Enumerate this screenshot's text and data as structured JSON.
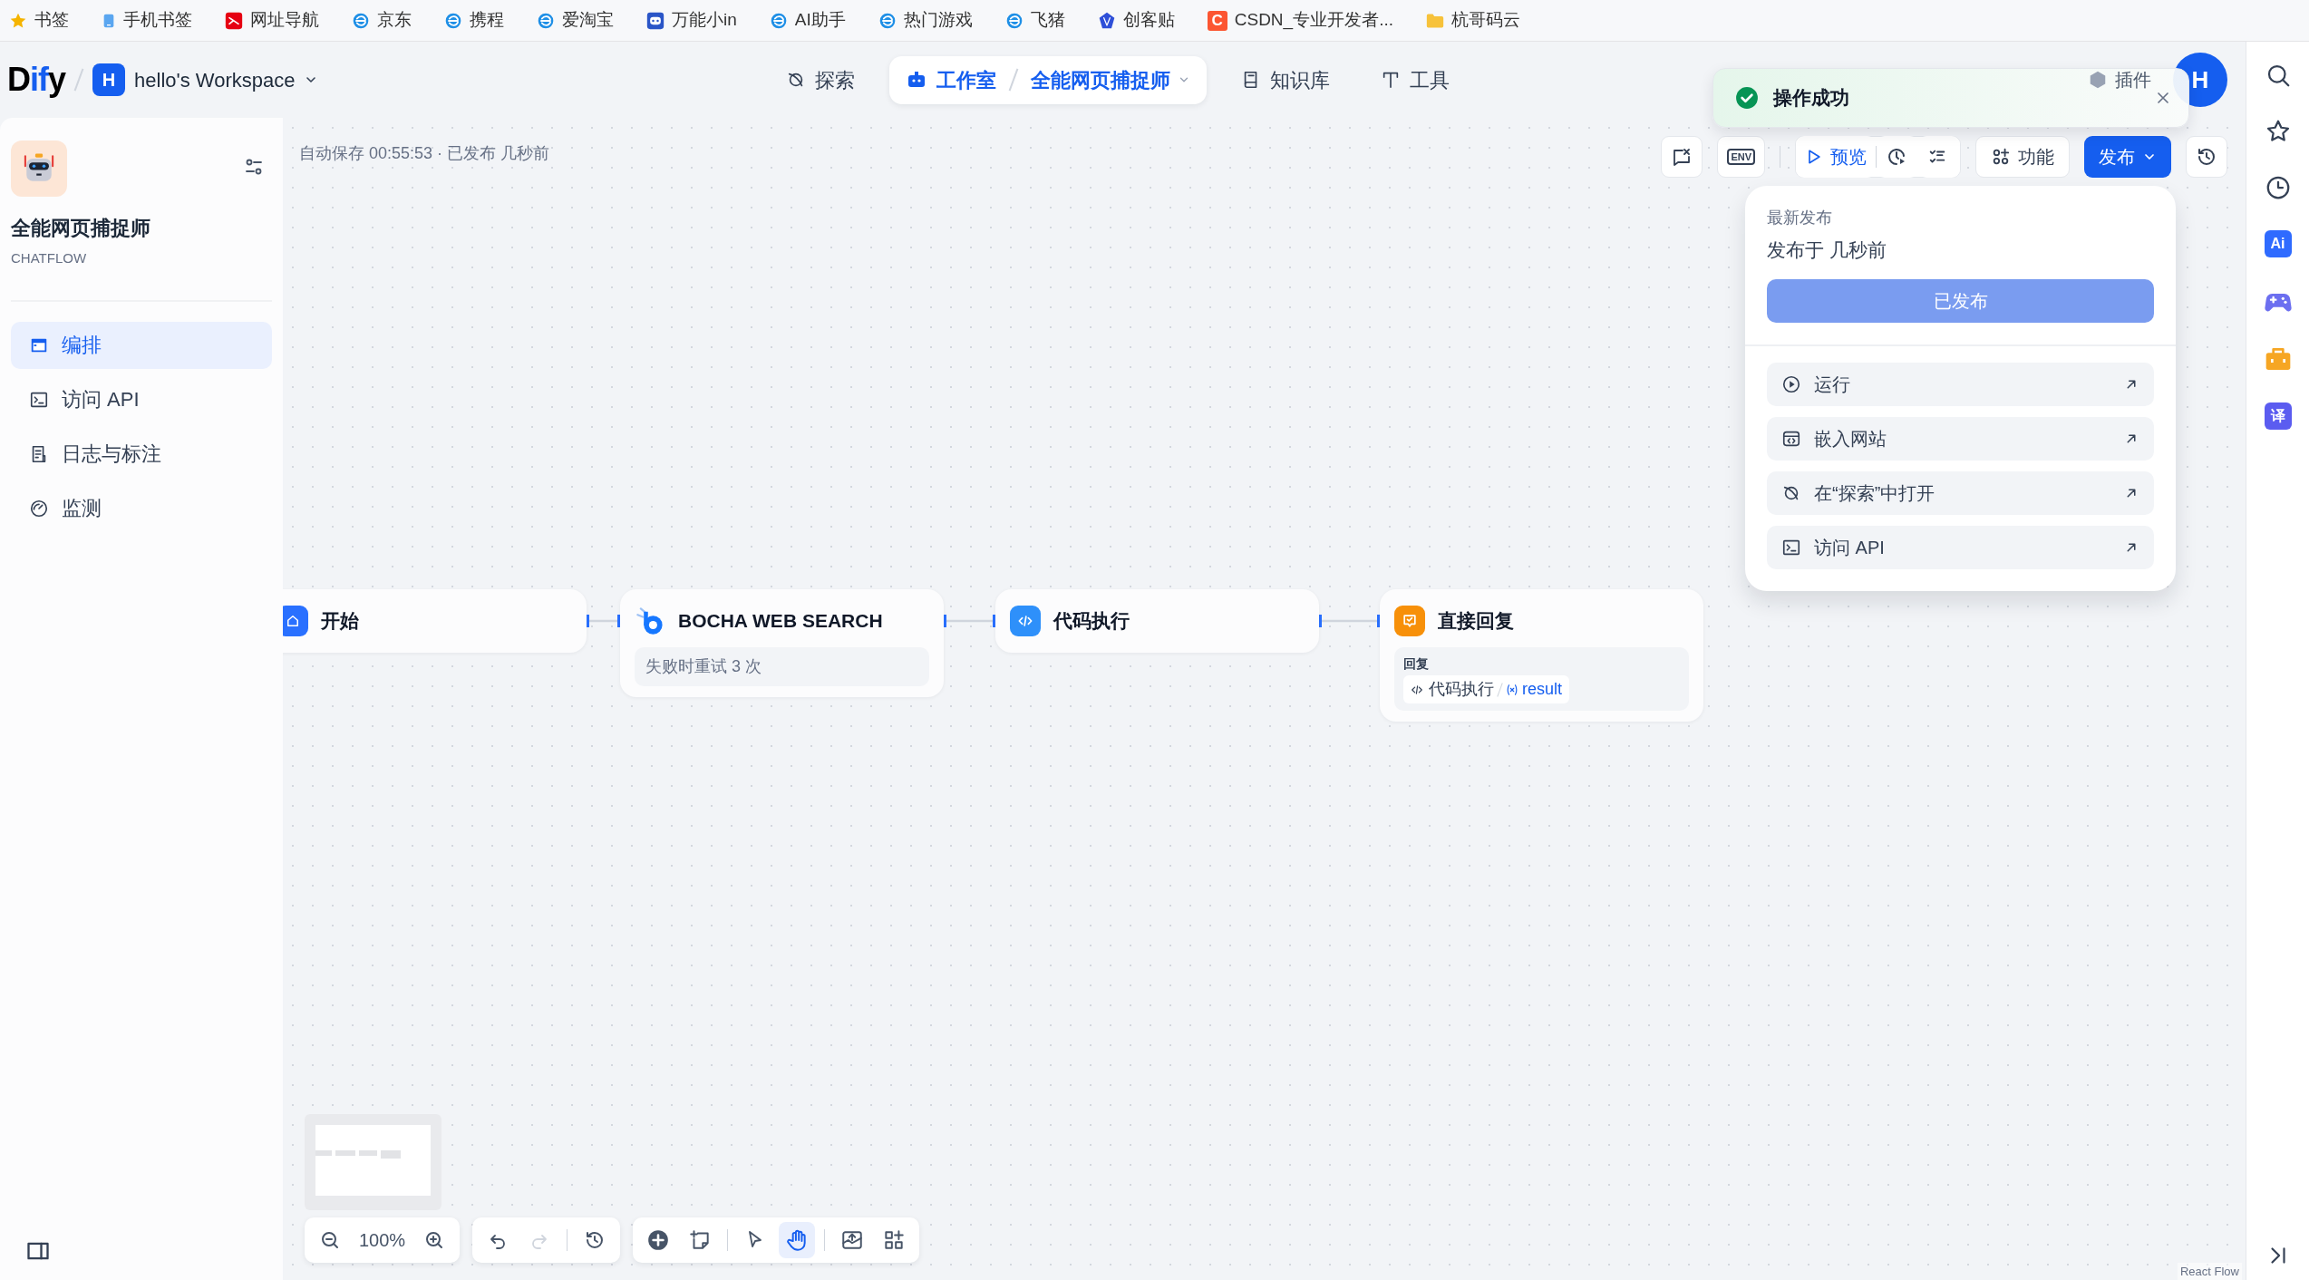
{
  "bookmarks": [
    {
      "label": "书签",
      "kind": "star"
    },
    {
      "label": "手机书签",
      "kind": "phone"
    },
    {
      "label": "网址导航",
      "kind": "red"
    },
    {
      "label": "京东",
      "kind": "browser"
    },
    {
      "label": "携程",
      "kind": "browser"
    },
    {
      "label": "爱淘宝",
      "kind": "browser"
    },
    {
      "label": "万能小in",
      "kind": "robot"
    },
    {
      "label": "AI助手",
      "kind": "browser"
    },
    {
      "label": "热门游戏",
      "kind": "browser"
    },
    {
      "label": "飞猪",
      "kind": "browser"
    },
    {
      "label": "创客贴",
      "kind": "gem"
    },
    {
      "label": "CSDN_专业开发者...",
      "kind": "letter",
      "letter": "C"
    },
    {
      "label": "杭哥码云",
      "kind": "folder"
    }
  ],
  "header": {
    "logo": "Dify",
    "workspace": {
      "initial": "H",
      "name": "hello's Workspace"
    },
    "nav": [
      {
        "label": "探索",
        "kind": "explore",
        "selected": false
      },
      {
        "label": "工作室",
        "kind": "studio",
        "selected": true,
        "current_app": "全能网页捕捉师"
      },
      {
        "label": "知识库",
        "kind": "knowledge",
        "selected": false
      },
      {
        "label": "工具",
        "kind": "tools",
        "selected": false
      }
    ],
    "plugins": "插件",
    "avatar": "H"
  },
  "toast": {
    "message": "操作成功",
    "kind": "success"
  },
  "sidebar": {
    "app_name": "全能网页捕捉师",
    "app_type": "CHATFLOW",
    "items": [
      {
        "label": "编排",
        "kind": "orchestrate",
        "selected": true
      },
      {
        "label": "访问 API",
        "kind": "api",
        "selected": false
      },
      {
        "label": "日志与标注",
        "kind": "logs",
        "selected": false
      },
      {
        "label": "监测",
        "kind": "monitor",
        "selected": false
      }
    ]
  },
  "canvas": {
    "status": "自动保存 00:55:53 · 已发布 几秒前",
    "toolbar": {
      "env": "ENV",
      "preview": "预览",
      "features": "功能",
      "publish": "发布"
    },
    "publish_menu": {
      "heading": "最新发布",
      "published_at": "发布于 几秒前",
      "button": {
        "label": "已发布",
        "disabled": true
      },
      "actions": [
        {
          "label": "运行",
          "kind": "run"
        },
        {
          "label": "嵌入网站",
          "kind": "embed"
        },
        {
          "label": "在“探索”中打开",
          "kind": "explore"
        },
        {
          "label": "访问 API",
          "kind": "api"
        }
      ]
    },
    "nodes": [
      {
        "title": "开始",
        "kind": "start"
      },
      {
        "title": "BOCHA WEB SEARCH",
        "kind": "tool",
        "note": "失败时重试 3 次"
      },
      {
        "title": "代码执行",
        "kind": "code"
      },
      {
        "title": "直接回复",
        "kind": "answer",
        "answer": {
          "label": "回复",
          "source": "代码执行",
          "variable": "result"
        }
      }
    ],
    "controls": {
      "zoom": "100%",
      "history": [
        {
          "kind": "undo",
          "disabled": false
        },
        {
          "kind": "redo",
          "disabled": true
        },
        {
          "kind": "history",
          "disabled": false
        }
      ],
      "tools": [
        {
          "kind": "add",
          "selected": false
        },
        {
          "kind": "note",
          "selected": false
        },
        {
          "kind": "pointer",
          "selected": false
        },
        {
          "kind": "hand",
          "selected": true
        },
        {
          "kind": "export",
          "selected": false
        },
        {
          "kind": "organize",
          "selected": false
        }
      ]
    },
    "attribution": "React Flow"
  },
  "browser_rail": [
    {
      "kind": "search"
    },
    {
      "kind": "star"
    },
    {
      "kind": "clock"
    },
    {
      "kind": "badge",
      "text": "Ai",
      "color": "#2f6bff"
    },
    {
      "kind": "gamepad"
    },
    {
      "kind": "briefcase"
    },
    {
      "kind": "badge",
      "text": "译",
      "color": "#5b5cf0"
    },
    {
      "kind": "collapse"
    }
  ]
}
